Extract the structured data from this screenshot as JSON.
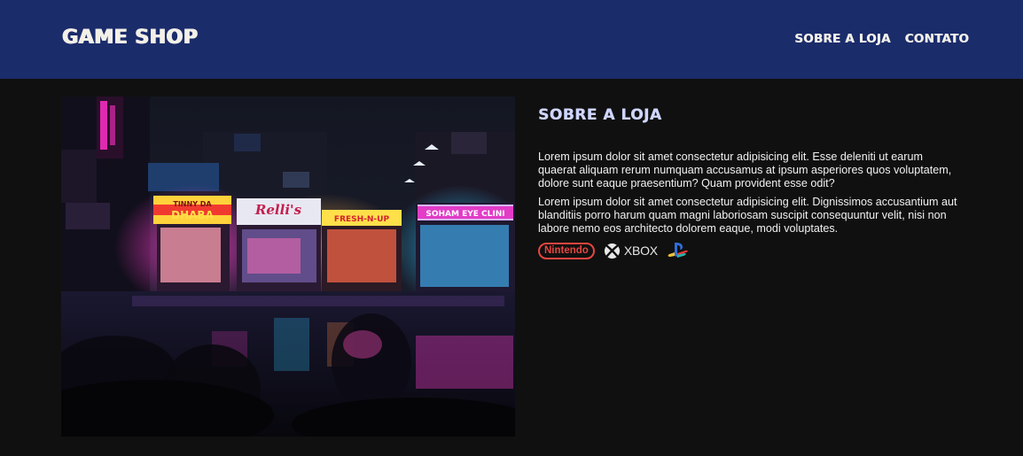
{
  "header": {
    "logo": "GAME SHOP",
    "nav": [
      {
        "label": "SOBRE A LOJA"
      },
      {
        "label": "CONTATO"
      }
    ]
  },
  "main": {
    "photo": {
      "signs": [
        "TINNY DA",
        "DHABA",
        "Relli's",
        "FRESH-N-UP",
        "SOHAM EYE CLINI"
      ]
    },
    "section_title": "SOBRE A LOJA",
    "paragraphs": [
      "Lorem ipsum dolor sit amet consectetur adipisicing elit. Esse deleniti ut earum quaerat aliquam rerum numquam accusamus at ipsum asperiores quos voluptatem, dolore sunt eaque praesentium? Quam provident esse odit?",
      "Lorem ipsum dolor sit amet consectetur adipisicing elit. Dignissimos accusantium aut blanditiis porro harum quam magni laboriosam suscipit consequuntur velit, nisi non labore nemo eos architecto dolorem eaque, modi voluptates."
    ],
    "brands": {
      "nintendo": "Nintendo",
      "xbox": "XBOX",
      "playstation_icon": "playstation-icon"
    }
  },
  "colors": {
    "header_bg": "#1b2c6b",
    "page_bg": "#101010",
    "nintendo_red": "#e7463f",
    "title_color": "#cfd6ff"
  }
}
